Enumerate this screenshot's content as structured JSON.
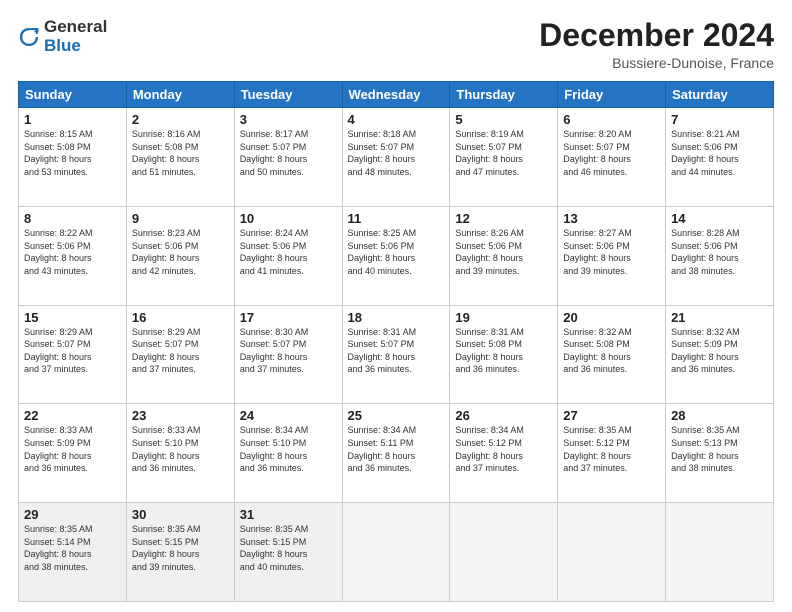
{
  "logo": {
    "general": "General",
    "blue": "Blue"
  },
  "header": {
    "month": "December 2024",
    "location": "Bussiere-Dunoise, France"
  },
  "days_of_week": [
    "Sunday",
    "Monday",
    "Tuesday",
    "Wednesday",
    "Thursday",
    "Friday",
    "Saturday"
  ],
  "weeks": [
    [
      {
        "day": 1,
        "info": "Sunrise: 8:15 AM\nSunset: 5:08 PM\nDaylight: 8 hours\nand 53 minutes."
      },
      {
        "day": 2,
        "info": "Sunrise: 8:16 AM\nSunset: 5:08 PM\nDaylight: 8 hours\nand 51 minutes."
      },
      {
        "day": 3,
        "info": "Sunrise: 8:17 AM\nSunset: 5:07 PM\nDaylight: 8 hours\nand 50 minutes."
      },
      {
        "day": 4,
        "info": "Sunrise: 8:18 AM\nSunset: 5:07 PM\nDaylight: 8 hours\nand 48 minutes."
      },
      {
        "day": 5,
        "info": "Sunrise: 8:19 AM\nSunset: 5:07 PM\nDaylight: 8 hours\nand 47 minutes."
      },
      {
        "day": 6,
        "info": "Sunrise: 8:20 AM\nSunset: 5:07 PM\nDaylight: 8 hours\nand 46 minutes."
      },
      {
        "day": 7,
        "info": "Sunrise: 8:21 AM\nSunset: 5:06 PM\nDaylight: 8 hours\nand 44 minutes."
      }
    ],
    [
      {
        "day": 8,
        "info": "Sunrise: 8:22 AM\nSunset: 5:06 PM\nDaylight: 8 hours\nand 43 minutes."
      },
      {
        "day": 9,
        "info": "Sunrise: 8:23 AM\nSunset: 5:06 PM\nDaylight: 8 hours\nand 42 minutes."
      },
      {
        "day": 10,
        "info": "Sunrise: 8:24 AM\nSunset: 5:06 PM\nDaylight: 8 hours\nand 41 minutes."
      },
      {
        "day": 11,
        "info": "Sunrise: 8:25 AM\nSunset: 5:06 PM\nDaylight: 8 hours\nand 40 minutes."
      },
      {
        "day": 12,
        "info": "Sunrise: 8:26 AM\nSunset: 5:06 PM\nDaylight: 8 hours\nand 39 minutes."
      },
      {
        "day": 13,
        "info": "Sunrise: 8:27 AM\nSunset: 5:06 PM\nDaylight: 8 hours\nand 39 minutes."
      },
      {
        "day": 14,
        "info": "Sunrise: 8:28 AM\nSunset: 5:06 PM\nDaylight: 8 hours\nand 38 minutes."
      }
    ],
    [
      {
        "day": 15,
        "info": "Sunrise: 8:29 AM\nSunset: 5:07 PM\nDaylight: 8 hours\nand 37 minutes."
      },
      {
        "day": 16,
        "info": "Sunrise: 8:29 AM\nSunset: 5:07 PM\nDaylight: 8 hours\nand 37 minutes."
      },
      {
        "day": 17,
        "info": "Sunrise: 8:30 AM\nSunset: 5:07 PM\nDaylight: 8 hours\nand 37 minutes."
      },
      {
        "day": 18,
        "info": "Sunrise: 8:31 AM\nSunset: 5:07 PM\nDaylight: 8 hours\nand 36 minutes."
      },
      {
        "day": 19,
        "info": "Sunrise: 8:31 AM\nSunset: 5:08 PM\nDaylight: 8 hours\nand 36 minutes."
      },
      {
        "day": 20,
        "info": "Sunrise: 8:32 AM\nSunset: 5:08 PM\nDaylight: 8 hours\nand 36 minutes."
      },
      {
        "day": 21,
        "info": "Sunrise: 8:32 AM\nSunset: 5:09 PM\nDaylight: 8 hours\nand 36 minutes."
      }
    ],
    [
      {
        "day": 22,
        "info": "Sunrise: 8:33 AM\nSunset: 5:09 PM\nDaylight: 8 hours\nand 36 minutes."
      },
      {
        "day": 23,
        "info": "Sunrise: 8:33 AM\nSunset: 5:10 PM\nDaylight: 8 hours\nand 36 minutes."
      },
      {
        "day": 24,
        "info": "Sunrise: 8:34 AM\nSunset: 5:10 PM\nDaylight: 8 hours\nand 36 minutes."
      },
      {
        "day": 25,
        "info": "Sunrise: 8:34 AM\nSunset: 5:11 PM\nDaylight: 8 hours\nand 36 minutes."
      },
      {
        "day": 26,
        "info": "Sunrise: 8:34 AM\nSunset: 5:12 PM\nDaylight: 8 hours\nand 37 minutes."
      },
      {
        "day": 27,
        "info": "Sunrise: 8:35 AM\nSunset: 5:12 PM\nDaylight: 8 hours\nand 37 minutes."
      },
      {
        "day": 28,
        "info": "Sunrise: 8:35 AM\nSunset: 5:13 PM\nDaylight: 8 hours\nand 38 minutes."
      }
    ],
    [
      {
        "day": 29,
        "info": "Sunrise: 8:35 AM\nSunset: 5:14 PM\nDaylight: 8 hours\nand 38 minutes."
      },
      {
        "day": 30,
        "info": "Sunrise: 8:35 AM\nSunset: 5:15 PM\nDaylight: 8 hours\nand 39 minutes."
      },
      {
        "day": 31,
        "info": "Sunrise: 8:35 AM\nSunset: 5:15 PM\nDaylight: 8 hours\nand 40 minutes."
      },
      {
        "day": null,
        "info": ""
      },
      {
        "day": null,
        "info": ""
      },
      {
        "day": null,
        "info": ""
      },
      {
        "day": null,
        "info": ""
      }
    ]
  ]
}
